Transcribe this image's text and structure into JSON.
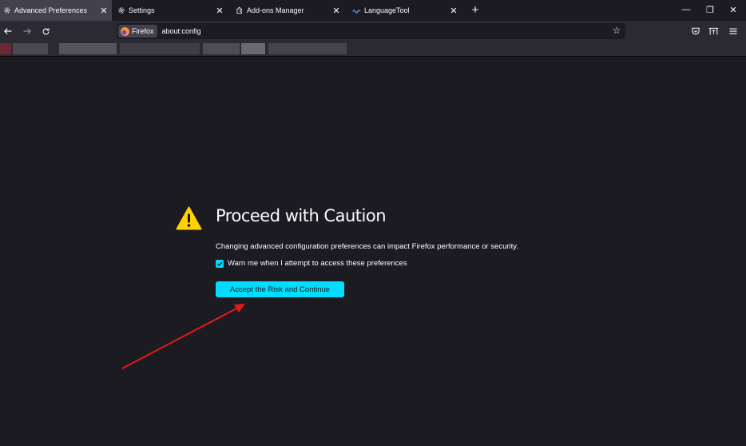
{
  "tabs": [
    {
      "title": "Advanced Preferences",
      "icon": "gear-icon",
      "active": true
    },
    {
      "title": "Settings",
      "icon": "gear-icon",
      "active": false
    },
    {
      "title": "Add-ons Manager",
      "icon": "puzzle-icon",
      "active": false
    },
    {
      "title": "LanguageTool",
      "icon": "languagetool-icon",
      "active": false
    }
  ],
  "window_controls": {
    "minimize": "—",
    "restore": "❐",
    "close": "✕"
  },
  "navbar": {
    "identity_label": "Firefox",
    "url": "about:config"
  },
  "content": {
    "title": "Proceed with Caution",
    "description": "Changing advanced configuration preferences can impact Firefox performance or security.",
    "checkbox_label": "Warn me when I attempt to access these preferences",
    "checkbox_checked": true,
    "accept_button": "Accept the Risk and Continue"
  },
  "colors": {
    "accent": "#00ddff",
    "warning": "#ffd100",
    "annotation_arrow": "#e01b1b"
  }
}
